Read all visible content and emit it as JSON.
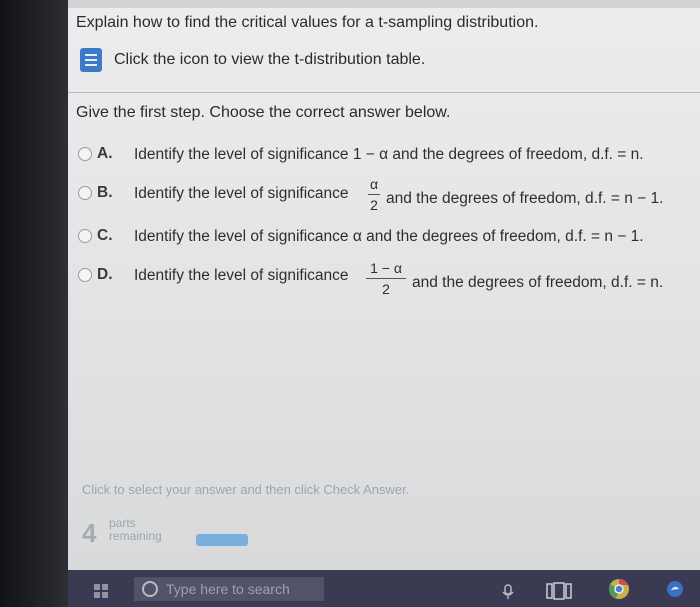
{
  "question": "Explain how to find the critical values for a t-sampling distribution.",
  "table_link": "Click the icon to view the t-distribution table.",
  "prompt": "Give the first step. Choose the correct answer below.",
  "options": [
    {
      "letter": "A.",
      "text": "Identify the level of significance 1 − α and the degrees of freedom, d.f. = n."
    },
    {
      "letter": "B.",
      "pre": "Identify the level of significance",
      "num": "α",
      "den": "2",
      "post": "and the degrees of freedom, d.f. = n − 1."
    },
    {
      "letter": "C.",
      "text": "Identify the level of significance α and the degrees of freedom, d.f. = n − 1."
    },
    {
      "letter": "D.",
      "pre": "Identify the level of significance",
      "num": "1 − α",
      "den": "2",
      "post": "and the degrees of freedom, d.f. = n."
    }
  ],
  "footer": {
    "hint": "Click to select your answer and then click Check Answer.",
    "parts_count": "4",
    "parts_label_1": "parts",
    "parts_label_2": "remaining"
  },
  "taskbar": {
    "search_placeholder": "Type here to search"
  },
  "colors": {
    "accent": "#3b79c9",
    "taskbar": "#3a3b52"
  }
}
